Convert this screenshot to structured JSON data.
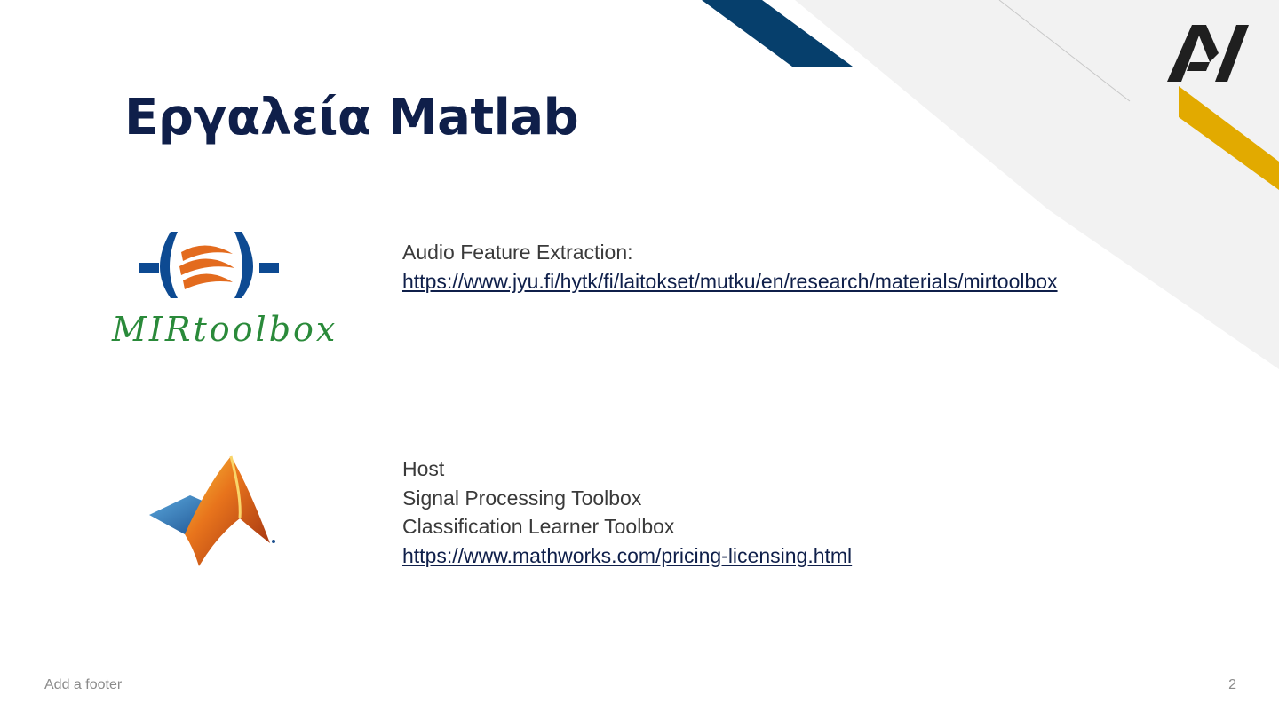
{
  "slide": {
    "title": "Εργαλεία Matlab",
    "colors": {
      "title": "#0f1f4a",
      "navy_band": "#063f6c",
      "gold_band": "#e2aa00",
      "grey_band": "#f2f2f2",
      "link": "#0f1f4a",
      "mir_green": "#2a8a3a",
      "mir_blue": "#0d4a92",
      "mir_orange": "#e36b1e"
    },
    "brand_logo": {
      "icon": "av-monogram-logo",
      "text": "AV"
    },
    "sections": [
      {
        "logo": {
          "icon": "mirtoolbox-logo",
          "text": "MIRtoolbox"
        },
        "lines": [
          "Audio Feature Extraction:"
        ],
        "link": "https://www.jyu.fi/hytk/fi/laitokset/mutku/en/research/materials/mirtoolbox"
      },
      {
        "logo": {
          "icon": "matlab-membrane-logo"
        },
        "lines": [
          "Host",
          "Signal Processing Toolbox",
          "Classification Learner Toolbox"
        ],
        "link": "https://www.mathworks.com/pricing-licensing.html"
      }
    ],
    "footer": "Add a footer",
    "page_number": "2"
  }
}
